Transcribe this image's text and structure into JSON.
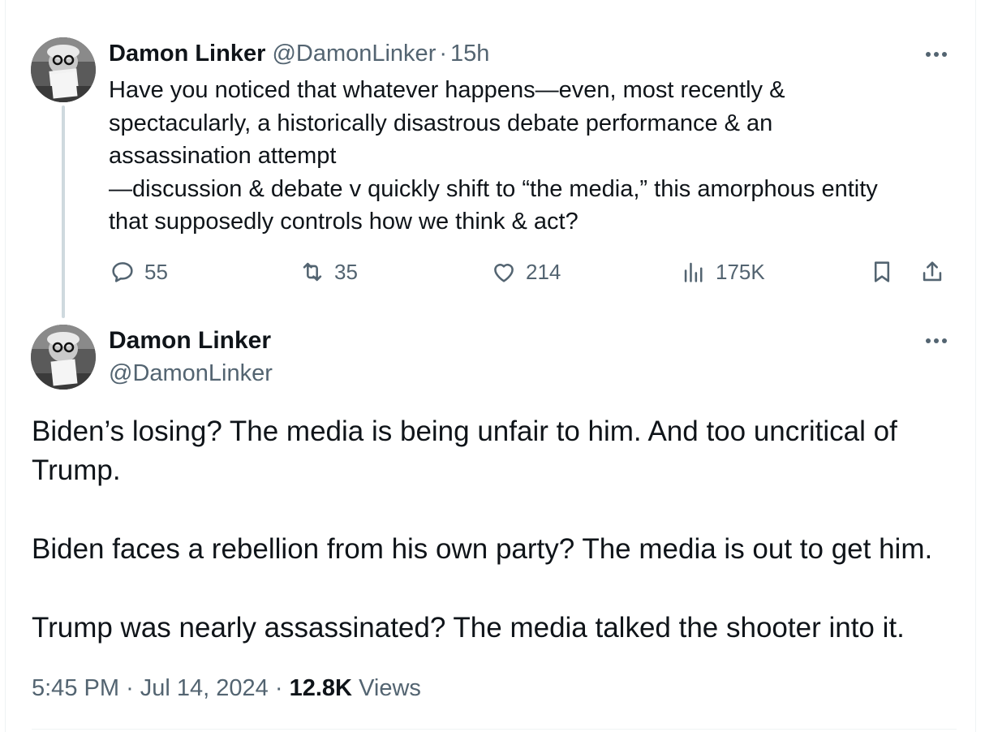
{
  "tweet1": {
    "author_name": "Damon Linker",
    "handle": "@DamonLinker",
    "separator": "·",
    "time": "15h",
    "text_lines": [
      "Have you noticed that whatever happens—even, most recently &",
      "spectacularly, a historically disastrous debate performance & an",
      "assassination attempt",
      "—discussion & debate v quickly shift to “the media,” this amorphous entity",
      "that supposedly controls how we think & act?"
    ],
    "stats": {
      "replies": "55",
      "reposts": "35",
      "likes": "214",
      "views": "175K"
    }
  },
  "tweet2": {
    "author_name": "Damon Linker",
    "handle": "@DamonLinker",
    "paragraphs": [
      "Biden’s losing? The media is being unfair to him. And too uncritical of Trump.",
      "Biden faces a rebellion from his own party? The media is out to get him.",
      "Trump was nearly assassinated? The media talked the shooter into it."
    ],
    "time": "5:45 PM",
    "date": "Jul 14, 2024",
    "separator": "·",
    "views_count": "12.8K",
    "views_label": "Views"
  },
  "icons": {
    "reply": "reply-icon",
    "repost": "repost-icon",
    "like": "heart-icon",
    "views": "analytics-icon",
    "bookmark": "bookmark-icon",
    "share": "share-icon",
    "more": "more-icon"
  },
  "colors": {
    "text": "#0f1419",
    "muted": "#536471",
    "thread_line": "#cfd9de"
  }
}
